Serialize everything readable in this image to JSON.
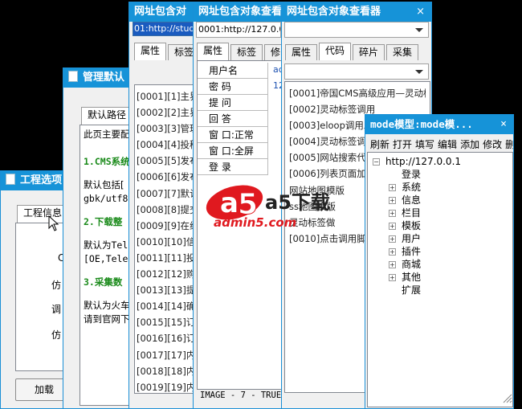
{
  "win_project": {
    "title": "工程选项",
    "tab": "工程信息",
    "labels": [
      "C",
      "仿",
      "调",
      "仿"
    ],
    "add_button": "加载"
  },
  "win_settings": {
    "title": "管理默认",
    "tab": "默认路径",
    "intro": "此页主要配",
    "h1": "1.CMS系统",
    "p1a": "默认包括[",
    "p1b": "gbk/utf8]",
    "h2": "2.下载整",
    "p2a": "默认为Tel",
    "p2b": "[OE,Telep",
    "h3": "3.采集数",
    "p3a": "默认为火车",
    "p3b": "请到官网下"
  },
  "win_a": {
    "title": "网址包含对",
    "url": "01:http://study.",
    "tabs": [
      "属性",
      "标签"
    ],
    "items": [
      "[0001][1]主界",
      "[0002][2]主界",
      "[0003][3]管理",
      "[0004][4]投稿",
      "[0005][5]发布",
      "[0006][6]发布",
      "[0007][7]默认",
      "[0008][8]提交",
      "[0009][9]在线",
      "[0010][10]信息",
      "[0011][11]投票",
      "[0012][12]购物",
      "[0013][13]提交",
      "[0014][14]确认",
      "[0015][15]订单",
      "[0016][16]订单",
      "[0017][17]内容",
      "[0018][18]内容",
      "[0019][19]内容"
    ]
  },
  "win_b": {
    "title": "网址包含对象查看",
    "url": "0001:http://127.0.0.1",
    "tabs": [
      "属性",
      "标签",
      "修"
    ],
    "fields": [
      "用户名",
      "密 码",
      "提 问",
      "回 答",
      "窗 口:正常",
      "窗 口:全屏",
      "登 录"
    ],
    "side_values": [
      "ac",
      "12"
    ],
    "status": "IMAGE - 7 - TRUE"
  },
  "win_c": {
    "title": "网址包含对象查看器",
    "close": "×",
    "tabs": [
      "属性",
      "代码",
      "碎片",
      "采集"
    ],
    "items": [
      "[0001]帝国CMS高级应用—灵动标",
      "[0002]灵动标签调用",
      "[0003]eloop调用发",
      "[0004]灵动标签调用",
      "[0005]网站搜索代码",
      "[0006]列表页面加关",
      "网站地图模版",
      "ss地图模版",
      "灵动标签做",
      "[0010]点击调用脚本"
    ]
  },
  "win_mode": {
    "title": "mode模型:mode模...",
    "close": "×",
    "menu": [
      "刷新",
      "打开",
      "填写",
      "编辑",
      "添加",
      "修改",
      "删"
    ],
    "tree_root": "http://127.0.0.1",
    "tree": [
      {
        "label": "登录",
        "expand": false
      },
      {
        "label": "系统",
        "expand": true
      },
      {
        "label": "信息",
        "expand": true
      },
      {
        "label": "栏目",
        "expand": true
      },
      {
        "label": "模板",
        "expand": true
      },
      {
        "label": "用户",
        "expand": true
      },
      {
        "label": "插件",
        "expand": true
      },
      {
        "label": "商城",
        "expand": true
      },
      {
        "label": "其他",
        "expand": true
      },
      {
        "label": "扩展",
        "expand": false
      }
    ]
  },
  "watermark": {
    "logo": "a5下载",
    "domain": "admin5.com"
  },
  "colors": {
    "title_bar": "#1693d8",
    "code_green": "#1a8a1a",
    "watermark_red": "#e0191f"
  }
}
